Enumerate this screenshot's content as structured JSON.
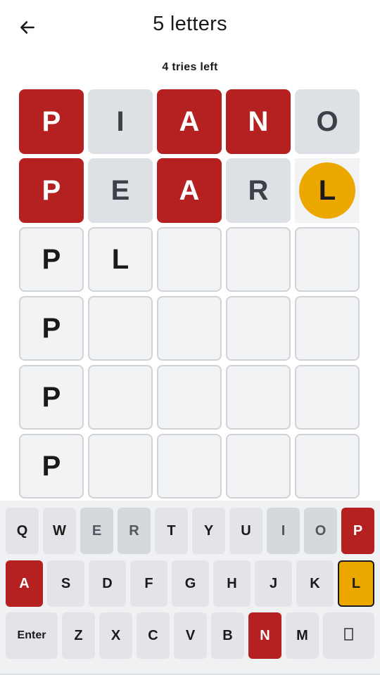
{
  "header": {
    "title": "5 letters",
    "back_icon": "arrow-left-icon"
  },
  "status": {
    "tries_left": "4 tries left"
  },
  "colors": {
    "red": "#b52020",
    "gray": "#dde0e4",
    "yellow": "#eda800",
    "empty": "#f1f3f5"
  },
  "grid": [
    [
      {
        "letter": "P",
        "state": "red"
      },
      {
        "letter": "I",
        "state": "gray"
      },
      {
        "letter": "A",
        "state": "red"
      },
      {
        "letter": "N",
        "state": "red"
      },
      {
        "letter": "O",
        "state": "gray"
      }
    ],
    [
      {
        "letter": "P",
        "state": "red"
      },
      {
        "letter": "E",
        "state": "gray"
      },
      {
        "letter": "A",
        "state": "red"
      },
      {
        "letter": "R",
        "state": "gray"
      },
      {
        "letter": "L",
        "state": "yellow-circle"
      }
    ],
    [
      {
        "letter": "P",
        "state": "empty"
      },
      {
        "letter": "L",
        "state": "empty"
      },
      {
        "letter": "",
        "state": "empty"
      },
      {
        "letter": "",
        "state": "empty"
      },
      {
        "letter": "",
        "state": "empty"
      }
    ],
    [
      {
        "letter": "P",
        "state": "empty"
      },
      {
        "letter": "",
        "state": "empty"
      },
      {
        "letter": "",
        "state": "empty"
      },
      {
        "letter": "",
        "state": "empty"
      },
      {
        "letter": "",
        "state": "empty"
      }
    ],
    [
      {
        "letter": "P",
        "state": "empty"
      },
      {
        "letter": "",
        "state": "empty"
      },
      {
        "letter": "",
        "state": "empty"
      },
      {
        "letter": "",
        "state": "empty"
      },
      {
        "letter": "",
        "state": "empty"
      }
    ],
    [
      {
        "letter": "P",
        "state": "empty"
      },
      {
        "letter": "",
        "state": "empty"
      },
      {
        "letter": "",
        "state": "empty"
      },
      {
        "letter": "",
        "state": "empty"
      },
      {
        "letter": "",
        "state": "empty"
      }
    ]
  ],
  "keyboard": {
    "row1": [
      {
        "label": "Q",
        "state": "default"
      },
      {
        "label": "W",
        "state": "default"
      },
      {
        "label": "E",
        "state": "gray"
      },
      {
        "label": "R",
        "state": "gray"
      },
      {
        "label": "T",
        "state": "default"
      },
      {
        "label": "Y",
        "state": "default"
      },
      {
        "label": "U",
        "state": "default"
      },
      {
        "label": "I",
        "state": "gray"
      },
      {
        "label": "O",
        "state": "gray"
      },
      {
        "label": "P",
        "state": "red"
      }
    ],
    "row2": [
      {
        "label": "A",
        "state": "red"
      },
      {
        "label": "S",
        "state": "default"
      },
      {
        "label": "D",
        "state": "default"
      },
      {
        "label": "F",
        "state": "default"
      },
      {
        "label": "G",
        "state": "default"
      },
      {
        "label": "H",
        "state": "default"
      },
      {
        "label": "J",
        "state": "default"
      },
      {
        "label": "K",
        "state": "default"
      },
      {
        "label": "L",
        "state": "yellow"
      }
    ],
    "row3": [
      {
        "label": "Enter",
        "state": "default"
      },
      {
        "label": "Z",
        "state": "default"
      },
      {
        "label": "X",
        "state": "default"
      },
      {
        "label": "C",
        "state": "default"
      },
      {
        "label": "V",
        "state": "default"
      },
      {
        "label": "B",
        "state": "default"
      },
      {
        "label": "N",
        "state": "red"
      },
      {
        "label": "M",
        "state": "default"
      },
      {
        "label": "",
        "state": "default",
        "icon": "backspace-icon"
      }
    ]
  }
}
